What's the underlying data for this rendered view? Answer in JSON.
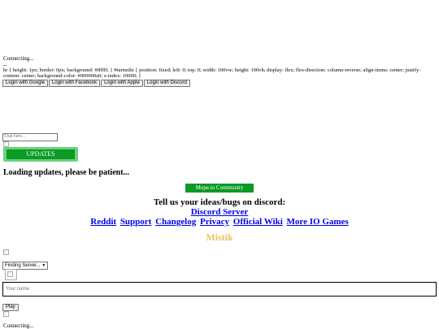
{
  "top_status": "Connecting...",
  "dashes": "--",
  "css_dump": "hr { height: 1px; border: 0px; background: #ffffff; } #turnstile { position: fixed; left: 0; top: 0; width: 100vw; height: 100vh; display: flex; flex-direction: column-reverse; align-items: center; justify-content: center; background-color: #000000a0; z-index: 10000; }",
  "login_buttons": [
    "Login with Google",
    "Login with Facebook",
    "Login with Apple",
    "Login with Discord"
  ],
  "chat": {
    "placeholder": "Chat here..."
  },
  "updates_label": "UPDATES",
  "loading_text": "Loading updates, please be patient...",
  "community_label": "Mope.io Community",
  "discord_prompt": "Tell us your ideas/bugs on discord:",
  "discord_link": "Discord Server",
  "footer_links": [
    "Reddit",
    "Support",
    "Changelog",
    "Privacy",
    "Official Wiki",
    "More IO Games"
  ],
  "featured_name": "Mistik",
  "featured_color": "#e8c15a",
  "server_select": {
    "selected": "Finding Server..."
  },
  "name_input": {
    "placeholder": "Your name"
  },
  "play_label": "Play",
  "bottom_status": "Connecting..."
}
